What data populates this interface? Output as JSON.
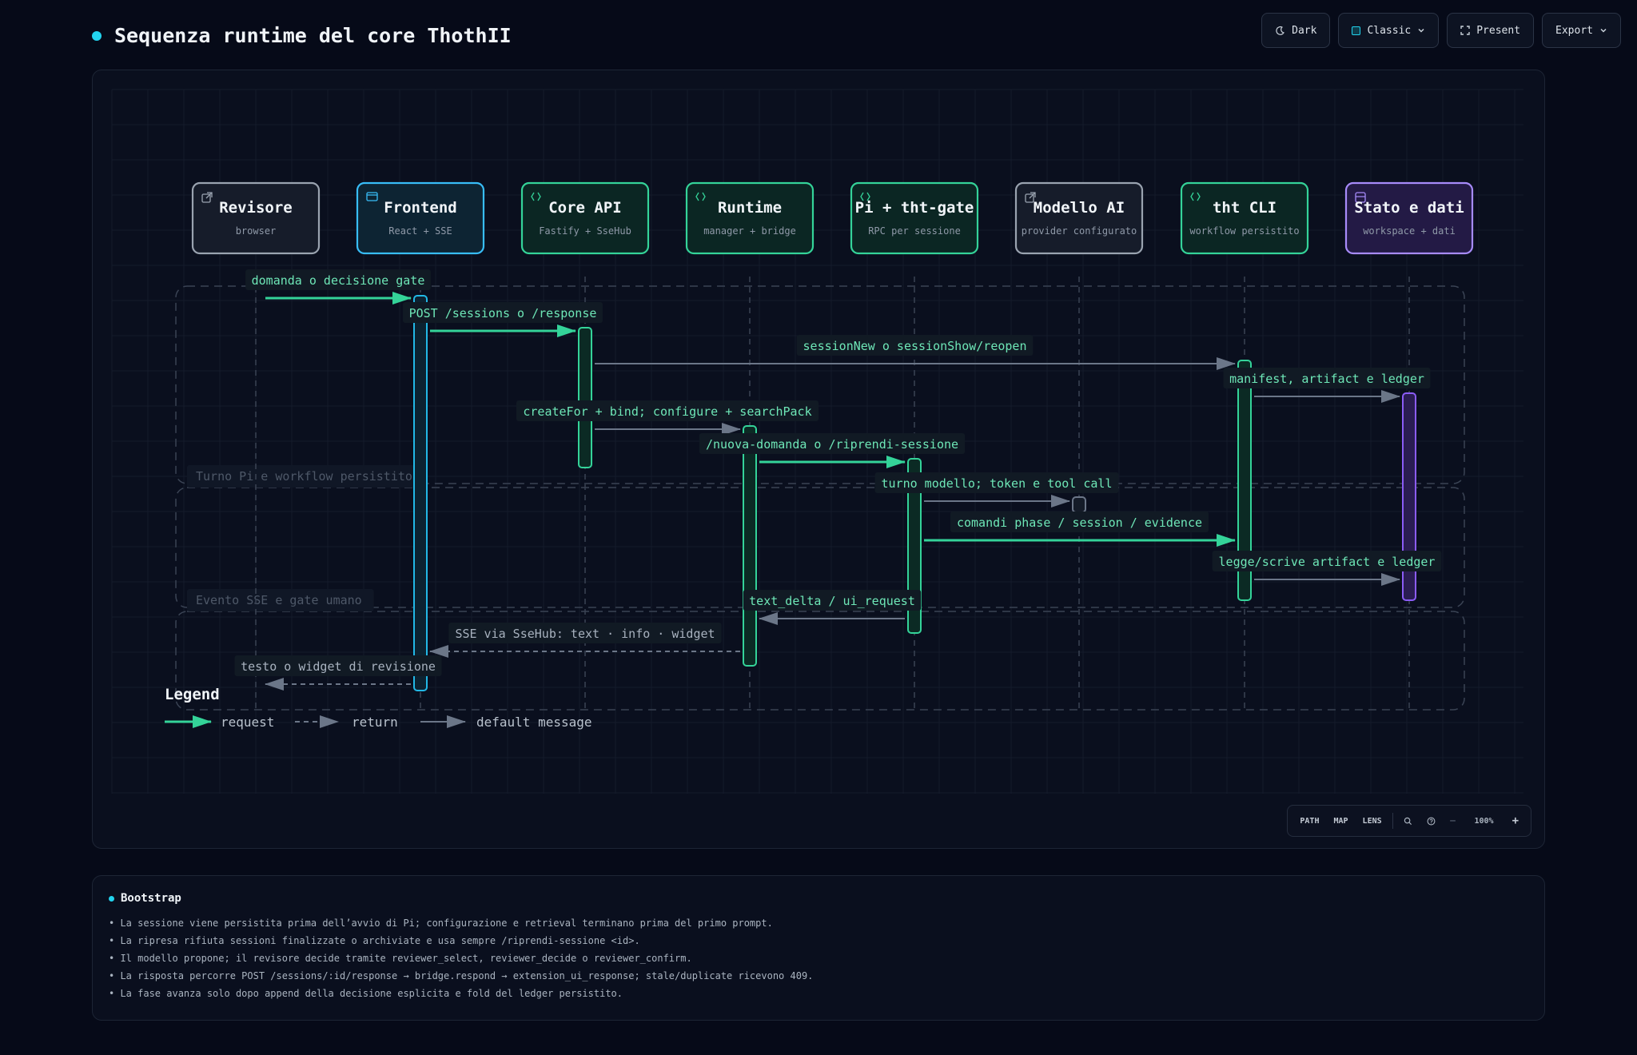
{
  "page": {
    "title": "Sequenza runtime del core ThothII"
  },
  "toolbar": {
    "theme_label": "Dark",
    "style_label": "Classic",
    "present_label": "Present",
    "export_label": "Export"
  },
  "participants": [
    {
      "id": "revisore",
      "name": "Revisore",
      "subtitle": "browser",
      "icon": "external-link-icon",
      "border": "#9aa3b0",
      "fill": "#161c2a",
      "kind": "actor"
    },
    {
      "id": "frontend",
      "name": "Frontend",
      "subtitle": "React + SSE",
      "icon": "browser-window-icon",
      "border": "#38bdf8",
      "fill": "#0d2433",
      "kind": "frontend"
    },
    {
      "id": "core-api",
      "name": "Core API",
      "subtitle": "Fastify + SseHub",
      "icon": "code-icon",
      "border": "#34d399",
      "fill": "#0b2623",
      "kind": "service"
    },
    {
      "id": "runtime",
      "name": "Runtime",
      "subtitle": "manager + bridge",
      "icon": "code-icon",
      "border": "#34d399",
      "fill": "#0b2623",
      "kind": "service"
    },
    {
      "id": "pi-gate",
      "name": "Pi + tht-gate",
      "subtitle": "RPC per sessione",
      "icon": "code-icon",
      "border": "#34d399",
      "fill": "#0b2623",
      "kind": "service"
    },
    {
      "id": "modello-ai",
      "name": "Modello AI",
      "subtitle": "provider configurato",
      "icon": "external-link-icon",
      "border": "#9aa3b0",
      "fill": "#161c2a",
      "kind": "actor"
    },
    {
      "id": "tht-cli",
      "name": "tht CLI",
      "subtitle": "workflow persistito",
      "icon": "code-icon",
      "border": "#34d399",
      "fill": "#0b2623",
      "kind": "service"
    },
    {
      "id": "stato-dati",
      "name": "Stato e dati",
      "subtitle": "workspace + dati",
      "icon": "database-icon",
      "border": "#a78bfa",
      "fill": "#231a45",
      "kind": "store"
    }
  ],
  "groups": [
    {
      "label": ""
    },
    {
      "label": "Turno Pi e workflow persistito"
    },
    {
      "label": "Evento SSE e gate umano"
    }
  ],
  "messages": [
    {
      "from": 0,
      "to": 1,
      "label": "domanda o decisione gate",
      "style": "request"
    },
    {
      "from": 1,
      "to": 2,
      "label": "POST /sessions o /response",
      "style": "request"
    },
    {
      "from": 2,
      "to": 6,
      "label": "sessionNew o sessionShow/reopen",
      "style": "default"
    },
    {
      "from": 6,
      "to": 7,
      "label": "manifest, artifact e ledger",
      "style": "default"
    },
    {
      "from": 2,
      "to": 3,
      "label": "createFor + bind; configure + searchPack",
      "style": "default"
    },
    {
      "from": 3,
      "to": 4,
      "label": "/nuova-domanda o /riprendi-sessione",
      "style": "request"
    },
    {
      "from": 4,
      "to": 5,
      "label": "turno modello; token e tool call",
      "style": "default"
    },
    {
      "from": 4,
      "to": 6,
      "label": "comandi phase / session / evidence",
      "style": "request"
    },
    {
      "from": 6,
      "to": 7,
      "label": "legge/scrive artifact e ledger",
      "style": "default"
    },
    {
      "from": 4,
      "to": 3,
      "label": "text_delta / ui_request",
      "style": "default"
    },
    {
      "from": 3,
      "to": 1,
      "label": "SSE via SseHub: text · info · widget",
      "style": "return"
    },
    {
      "from": 1,
      "to": 0,
      "label": "testo o widget di revisione",
      "style": "return"
    }
  ],
  "legend": {
    "title": "Legend",
    "request_label": "request",
    "return_label": "return",
    "default_label": "default message"
  },
  "colors": {
    "request": "#34d399",
    "default": "#6b7688",
    "return": "#6b7688",
    "group": "#3a4354",
    "lifeline": "#3a4354",
    "label_bg": "#111a24",
    "label_text": "#6ee7b7"
  },
  "zoom_bar": {
    "path_label": "PATH",
    "map_label": "MAP",
    "lens_label": "LENS",
    "zoom_level": "100%",
    "minus_label": "−",
    "plus_label": "+"
  },
  "notes": {
    "title": "Bootstrap",
    "items": [
      "La sessione viene persistita prima dell’avvio di Pi; configurazione e retrieval terminano prima del primo prompt.",
      "La ripresa rifiuta sessioni finalizzate o archiviate e usa sempre /riprendi-sessione <id>.",
      "Il modello propone; il revisore decide tramite reviewer_select, reviewer_decide o reviewer_confirm.",
      "La risposta percorre POST /sessions/:id/response → bridge.respond → extension_ui_response; stale/duplicate ricevono 409.",
      "La fase avanza solo dopo append della decisione esplicita e fold del ledger persistito."
    ]
  }
}
